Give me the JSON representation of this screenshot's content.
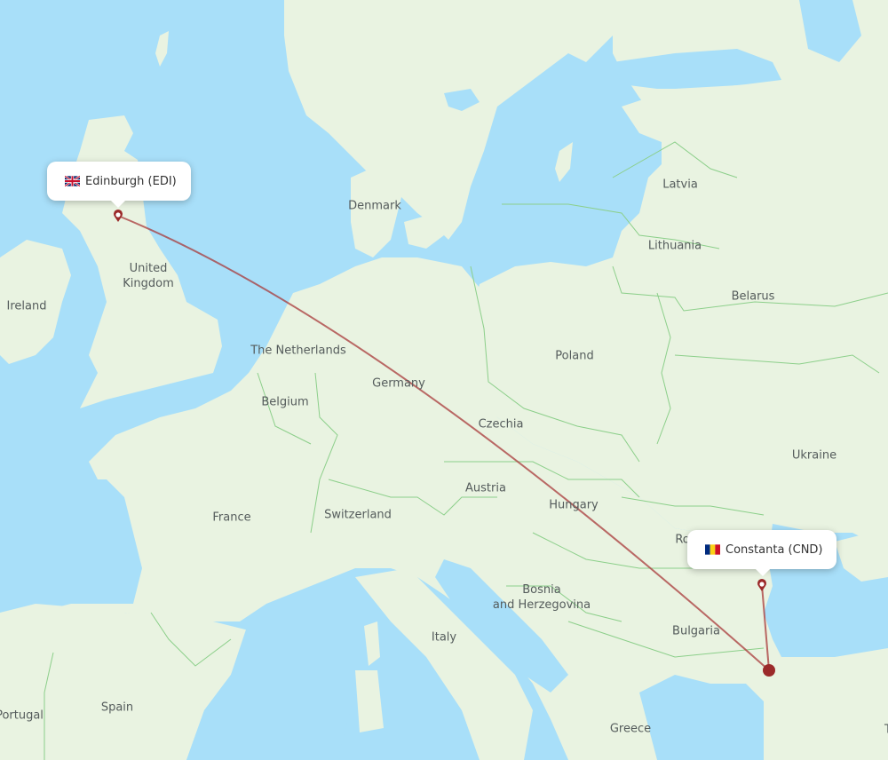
{
  "map": {
    "route_color": "#a83a3a",
    "marker_color": "#9b2a2a",
    "water_color": "#a8dff9",
    "land_color": "#e9f3e1",
    "border_color": "#8ccf8a"
  },
  "airports": {
    "origin": {
      "label": "Edinburgh (EDI)",
      "city": "Edinburgh",
      "code": "EDI",
      "flag": "uk-flag-icon"
    },
    "destination": {
      "label": "Constanta (CND)",
      "city": "Constanta",
      "code": "CND",
      "flag": "romania-flag-icon"
    }
  },
  "countries": [
    {
      "name": "Latvia"
    },
    {
      "name": "Denmark"
    },
    {
      "name": "Lithuania"
    },
    {
      "name": "United\nKingdom"
    },
    {
      "name": "Belarus"
    },
    {
      "name": "Ireland"
    },
    {
      "name": "The Netherlands"
    },
    {
      "name": "Poland"
    },
    {
      "name": "Germany"
    },
    {
      "name": "Belgium"
    },
    {
      "name": "Czechia"
    },
    {
      "name": "Ukraine"
    },
    {
      "name": "Austria"
    },
    {
      "name": "France"
    },
    {
      "name": "Switzerland"
    },
    {
      "name": "Hungary"
    },
    {
      "name": "Roman"
    },
    {
      "name": "Bosnia\nand Herzegovina"
    },
    {
      "name": "Bulgaria"
    },
    {
      "name": "Italy"
    },
    {
      "name": "Spain"
    },
    {
      "name": "Portugal"
    },
    {
      "name": "Greece"
    },
    {
      "name": "T"
    }
  ]
}
